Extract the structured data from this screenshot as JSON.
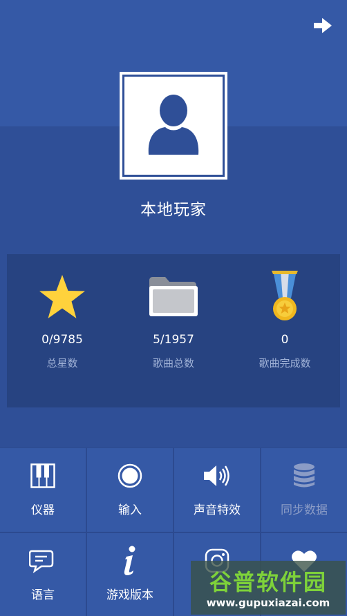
{
  "header": {
    "logout_icon": "arrow-right-icon"
  },
  "profile": {
    "avatar_icon": "user-silhouette-icon",
    "name": "本地玩家"
  },
  "stats": [
    {
      "icon": "star-icon",
      "value": "0/9785",
      "label": "总星数"
    },
    {
      "icon": "folder-icon",
      "value": "5/1957",
      "label": "歌曲总数"
    },
    {
      "icon": "medal-icon",
      "value": "0",
      "label": "歌曲完成数"
    }
  ],
  "menu": [
    {
      "icon": "piano-keys-icon",
      "label": "仪器",
      "enabled": true
    },
    {
      "icon": "record-circle-icon",
      "label": "输入",
      "enabled": true
    },
    {
      "icon": "speaker-icon",
      "label": "声音特效",
      "enabled": true
    },
    {
      "icon": "database-icon",
      "label": "同步数据",
      "enabled": false
    },
    {
      "icon": "speech-bubble-icon",
      "label": "语言",
      "enabled": true
    },
    {
      "icon": "info-icon",
      "label": "游戏版本",
      "enabled": true
    },
    {
      "icon": "instagram-icon",
      "label": "",
      "enabled": true
    },
    {
      "icon": "heart-icon",
      "label": "",
      "enabled": true
    }
  ],
  "watermark": {
    "title": "谷普软件园",
    "url": "www.gupuxiazai.com"
  },
  "colors": {
    "background": "#2f4e96",
    "tile": "#3559a6",
    "panel": "#274381",
    "star": "#ffd23c",
    "medal_ribbon": "#4a8fd8",
    "watermark_green": "#7ed23a"
  }
}
